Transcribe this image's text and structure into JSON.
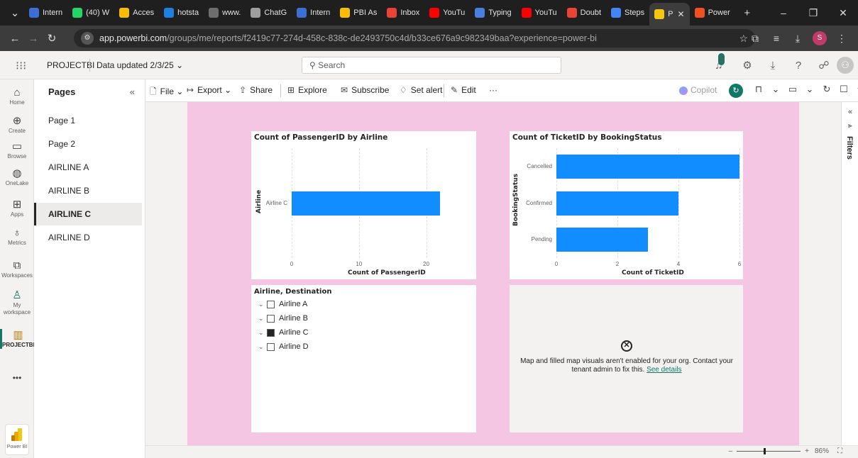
{
  "browser": {
    "tabs": [
      {
        "label": "Intern",
        "color": "#3b6fd6"
      },
      {
        "label": "(40) W",
        "color": "#25d366"
      },
      {
        "label": "Acces",
        "color": "#fbbc04"
      },
      {
        "label": "hotsta",
        "color": "#1f80e0"
      },
      {
        "label": "www.",
        "color": "#6e6e6e"
      },
      {
        "label": "ChatG",
        "color": "#9e9e9e"
      },
      {
        "label": "Intern",
        "color": "#3b6fd6"
      },
      {
        "label": "PBI As",
        "color": "#fbbc04"
      },
      {
        "label": "Inbox",
        "color": "#ea4335"
      },
      {
        "label": "YouTu",
        "color": "#ff0000"
      },
      {
        "label": "Typing",
        "color": "#4a7ee0"
      },
      {
        "label": "YouTu",
        "color": "#ff0000"
      },
      {
        "label": "Doubt",
        "color": "#ea4335"
      },
      {
        "label": "Steps",
        "color": "#4285f4"
      },
      {
        "label": "P",
        "color": "#f2c811",
        "active": true
      },
      {
        "label": "Power",
        "color": "#f25022"
      }
    ],
    "url_host": "app.powerbi.com",
    "url_path": "/groups/me/reports/f2419c77-274d-458c-838c-de2493750c4d/b33ce676a9c982349baa?experience=power-bi",
    "profile_initial": "S"
  },
  "header": {
    "workspace": "PROJECTBI",
    "updated": "Data updated 2/3/25",
    "search_placeholder": "Search",
    "notifications": "5"
  },
  "rail": {
    "items": [
      {
        "label": "Home",
        "icon": "home-icon",
        "glyph": "⌂"
      },
      {
        "label": "Create",
        "icon": "create-icon",
        "glyph": "⊕"
      },
      {
        "label": "Browse",
        "icon": "browse-icon",
        "glyph": "▭"
      },
      {
        "label": "OneLake",
        "icon": "onelake-icon",
        "glyph": "◍"
      },
      {
        "label": "Apps",
        "icon": "apps-icon",
        "glyph": "⊞"
      },
      {
        "label": "Metrics",
        "icon": "metrics-icon",
        "glyph": "♁"
      },
      {
        "label": "Workspaces",
        "icon": "workspaces-icon",
        "glyph": "⧉"
      },
      {
        "label": "My workspace",
        "icon": "my-workspace-icon",
        "glyph": "♙"
      },
      {
        "label": "PROJECTBI",
        "icon": "projectbi-icon",
        "glyph": "▥"
      }
    ],
    "more": "•••",
    "product": "Power BI"
  },
  "pages_panel": {
    "title": "Pages",
    "items": [
      "Page 1",
      "Page 2",
      "AIRLINE A",
      "AIRLINE B",
      "AIRLINE C",
      "AIRLINE D"
    ],
    "active_index": 4
  },
  "actionbar": {
    "file": "File",
    "export": "Export",
    "share": "Share",
    "explore": "Explore",
    "subscribe": "Subscribe",
    "set_alert": "Set alert",
    "edit": "Edit",
    "more": "···",
    "copilot": "Copilot"
  },
  "slicer": {
    "title": "Airline, Destination",
    "items": [
      {
        "label": "Airline A",
        "checked": false
      },
      {
        "label": "Airline B",
        "checked": false
      },
      {
        "label": "Airline C",
        "checked": true
      },
      {
        "label": "Airline D",
        "checked": false
      }
    ]
  },
  "map_visual": {
    "message": "Map and filled map visuals aren't enabled for your org. Contact your tenant admin to fix this.",
    "link": "See details"
  },
  "filters_pane": {
    "label": "Filters"
  },
  "statusbar": {
    "zoom": "86%"
  },
  "colors": {
    "bar": "#118dff",
    "canvas": "#f5c6e4",
    "accent": "#117865"
  },
  "chart_data": [
    {
      "type": "bar",
      "orientation": "horizontal",
      "title": "Count of PassengerID by Airline",
      "xlabel": "Count of PassengerID",
      "ylabel": "Airline",
      "categories": [
        "Airline C"
      ],
      "values": [
        22
      ],
      "xlim": [
        0,
        25
      ],
      "xticks": [
        0,
        10,
        20
      ],
      "grid": true
    },
    {
      "type": "bar",
      "orientation": "horizontal",
      "title": "Count of TicketID by BookingStatus",
      "xlabel": "Count of TicketID",
      "ylabel": "BookingStatus",
      "categories": [
        "Cancelled",
        "Confirmed",
        "Pending"
      ],
      "values": [
        6,
        4,
        3
      ],
      "xlim": [
        0,
        6
      ],
      "xticks": [
        0,
        2,
        4,
        6
      ],
      "grid": true
    }
  ]
}
